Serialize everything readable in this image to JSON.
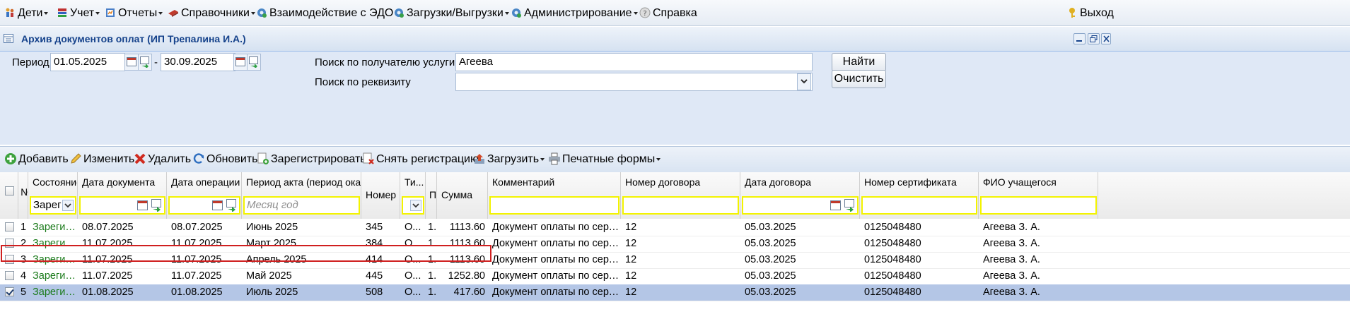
{
  "menu": {
    "items": [
      {
        "label": "Дети",
        "icon": "children-icon"
      },
      {
        "label": "Учет",
        "icon": "books-icon"
      },
      {
        "label": "Отчеты",
        "icon": "reports-icon"
      },
      {
        "label": "Справочники",
        "icon": "directory-icon"
      },
      {
        "label": "Взаимодействие с ЭДО",
        "icon": "gear-icon"
      },
      {
        "label": "Загрузки/Выгрузки",
        "icon": "gear-icon"
      },
      {
        "label": "Администрирование",
        "icon": "gear-icon"
      },
      {
        "label": "Справка",
        "icon": "help-icon"
      }
    ],
    "exit_label": "Выход"
  },
  "window": {
    "title": "Архив документов оплат (ИП Трепалина И.А.)"
  },
  "filters": {
    "period_label": "Период:",
    "period_from": "01.05.2025",
    "period_sep": "-",
    "period_to": "30.09.2025",
    "recipient_label": "Поиск по получателю услуги",
    "recipient_value": "Агеева",
    "requisite_label": "Поиск по реквизиту",
    "requisite_value": "",
    "find_label": "Найти",
    "clear_label": "Очистить"
  },
  "toolbar": {
    "add": "Добавить",
    "edit": "Изменить",
    "delete": "Удалить",
    "refresh": "Обновить",
    "register": "Зарегистрировать",
    "unregister": "Снять регистрацию",
    "load": "Загрузить",
    "print": "Печатные формы"
  },
  "grid": {
    "headers": {
      "num": "№",
      "state": "Состояние",
      "doc_date": "Дата документа",
      "op_date": "Дата операции",
      "period": "Период акта (период ока...",
      "number": "Номер",
      "type": "Ти...",
      "p": "П.",
      "sum": "Сумма",
      "comment": "Комментарий",
      "contract_no": "Номер договора",
      "contract_date": "Дата договора",
      "certificate": "Номер сертификата",
      "student": "ФИО учащегося"
    },
    "filter_state_value": "Зарегистрирован",
    "filter_period_placeholder": "Месяц год",
    "rows": [
      {
        "n": "1",
        "state": "Зарегистрирован",
        "doc_date": "08.07.2025",
        "op_date": "08.07.2025",
        "period": "Июнь 2025",
        "number": "345",
        "type": "О...",
        "p": "1.",
        "sum": "1113.60",
        "comment": "Документ оплаты по сертификату",
        "contract_no": "12",
        "contract_date": "05.03.2025",
        "certificate": "0125048480",
        "student": "Агеева З. А.",
        "checked": false
      },
      {
        "n": "2",
        "state": "Зарегистрирован",
        "doc_date": "11.07.2025",
        "op_date": "11.07.2025",
        "period": "Март 2025",
        "number": "384",
        "type": "О...",
        "p": "1.",
        "sum": "1113.60",
        "comment": "Документ оплаты по сертификату",
        "contract_no": "12",
        "contract_date": "05.03.2025",
        "certificate": "0125048480",
        "student": "Агеева З. А.",
        "checked": false
      },
      {
        "n": "3",
        "state": "Зарегистрирован",
        "doc_date": "11.07.2025",
        "op_date": "11.07.2025",
        "period": "Апрель 2025",
        "number": "414",
        "type": "О...",
        "p": "1.",
        "sum": "1113.60",
        "comment": "Документ оплаты по сертификату",
        "contract_no": "12",
        "contract_date": "05.03.2025",
        "certificate": "0125048480",
        "student": "Агеева З. А.",
        "checked": false
      },
      {
        "n": "4",
        "state": "Зарегистрирован",
        "doc_date": "11.07.2025",
        "op_date": "11.07.2025",
        "period": "Май 2025",
        "number": "445",
        "type": "О...",
        "p": "1.",
        "sum": "1252.80",
        "comment": "Документ оплаты по сертификату",
        "contract_no": "12",
        "contract_date": "05.03.2025",
        "certificate": "0125048480",
        "student": "Агеева З. А.",
        "checked": false
      },
      {
        "n": "5",
        "state": "Зарегистрирован",
        "doc_date": "01.08.2025",
        "op_date": "01.08.2025",
        "period": "Июль 2025",
        "number": "508",
        "type": "О...",
        "p": "1.",
        "sum": "417.60",
        "comment": "Документ оплаты по сертификату",
        "contract_no": "12",
        "contract_date": "05.03.2025",
        "certificate": "0125048480",
        "student": "Агеева З. А.",
        "checked": true
      }
    ]
  },
  "colors": {
    "accent": "#15428b",
    "selected_row": "#b4c6e6",
    "highlight_border": "#d01f1f",
    "filter_border": "#f3f300",
    "state_text": "#1a7a1a"
  }
}
